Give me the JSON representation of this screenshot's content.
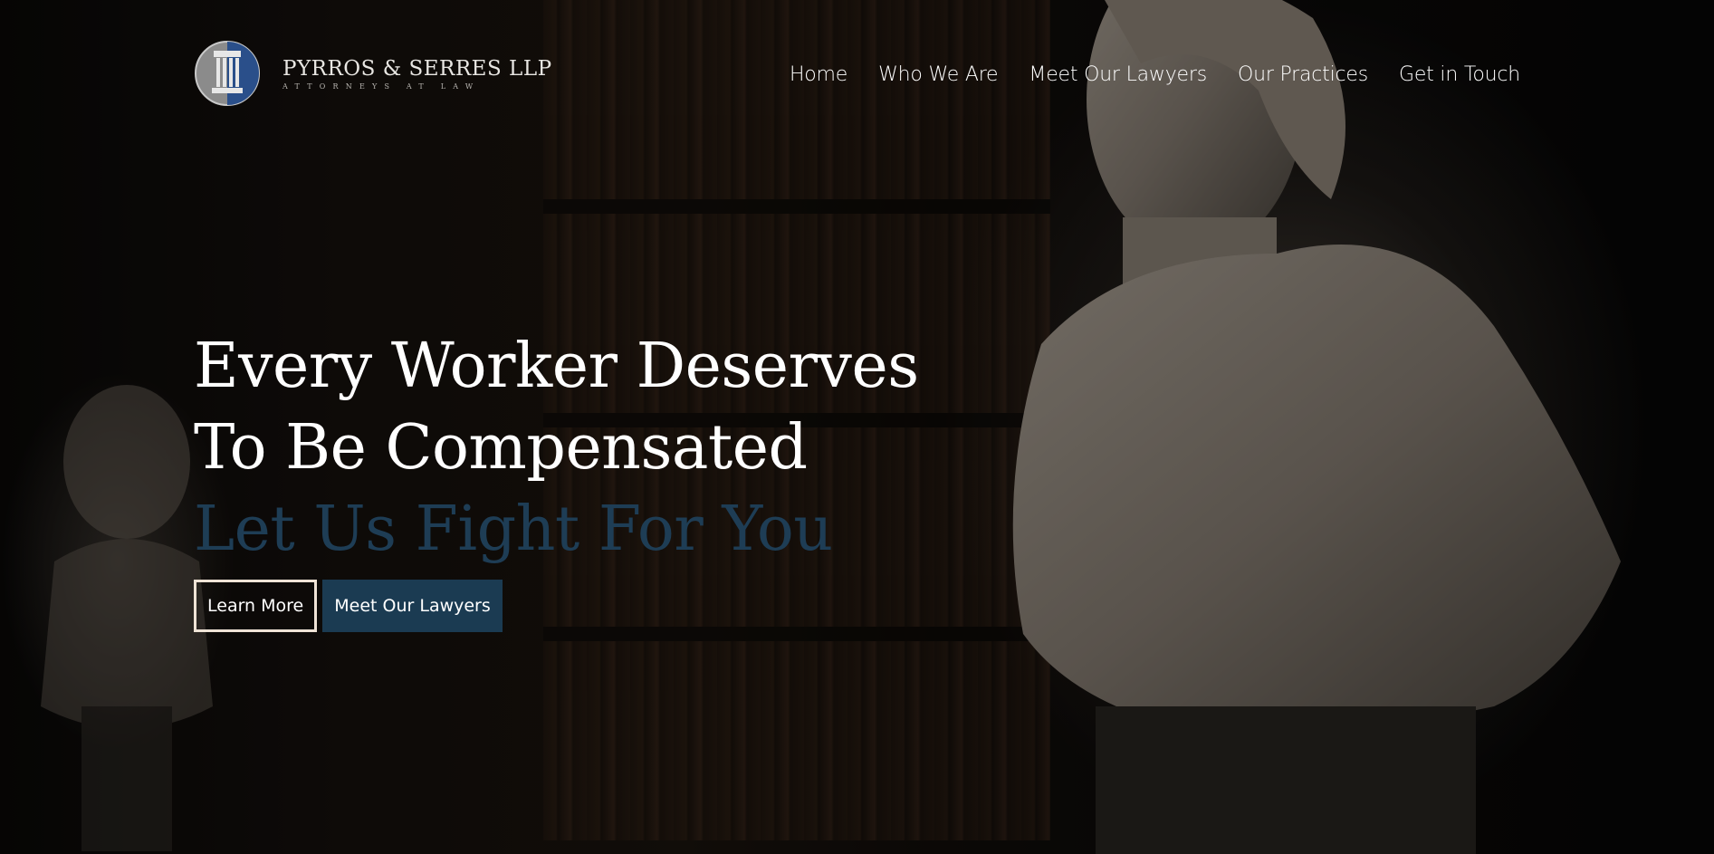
{
  "brand": {
    "name": "PYRROS & SERRES LLP",
    "tagline": "ATTORNEYS AT LAW",
    "logo_icon": "column-pillar-icon"
  },
  "nav": {
    "items": [
      {
        "label": "Home"
      },
      {
        "label": "Who We Are"
      },
      {
        "label": "Meet Our Lawyers"
      },
      {
        "label": "Our Practices"
      },
      {
        "label": "Get in Touch"
      }
    ]
  },
  "hero": {
    "line1": "Every Worker Deserves",
    "line2": "To Be Compensated",
    "accent_line": "Let Us Fight For You",
    "primary_button": "Learn More",
    "secondary_button": "Meet Our Lawyers"
  },
  "colors": {
    "accent": "#1e3d55",
    "button_solid": "#1b3b52",
    "button_border": "#efe3d6",
    "logo_blue": "#2a4f8a"
  }
}
